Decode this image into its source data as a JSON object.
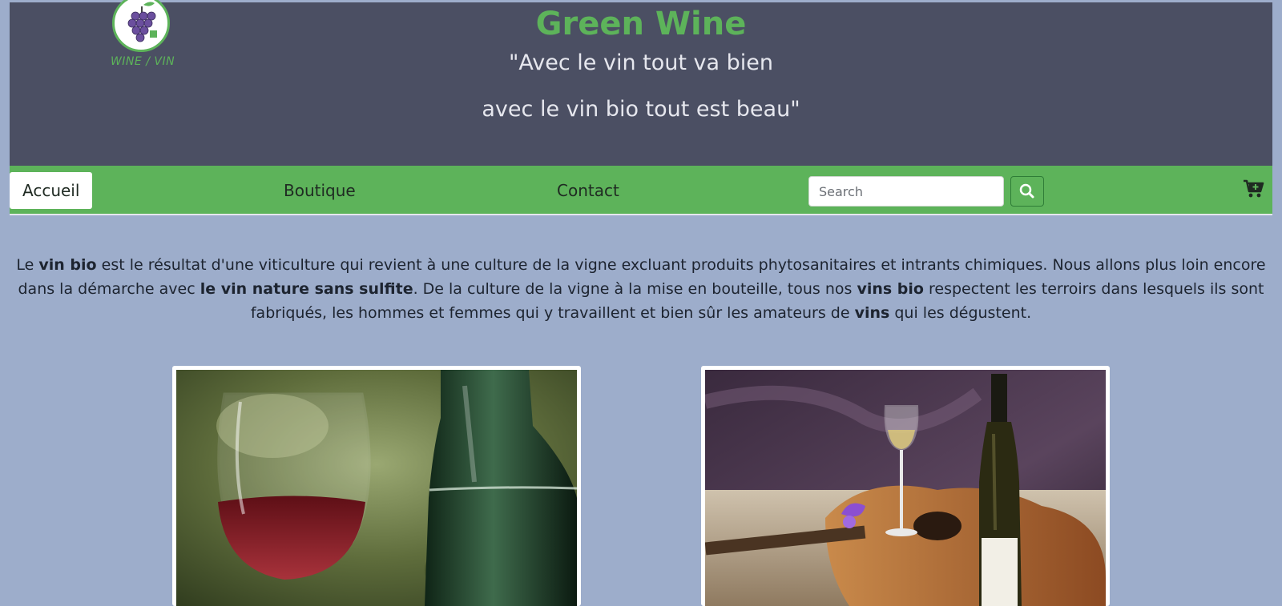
{
  "header": {
    "title": "Green Wine",
    "tagline_line1": "\"Avec le vin tout va bien",
    "tagline_line2": "avec le vin bio tout est beau\"",
    "logo_text": "WINE / VIN"
  },
  "nav": {
    "items": [
      {
        "label": "Accueil"
      },
      {
        "label": "Boutique"
      },
      {
        "label": "Contact"
      }
    ],
    "search_placeholder": "Search",
    "search_icon": "search-icon",
    "cart_icon": "cart-plus-icon"
  },
  "intro": {
    "p1": "Le ",
    "b1": "vin bio",
    "p2": " est le résultat d'une viticulture qui revient à une culture de la vigne excluant produits phytosanitaires et intrants chimiques. Nous allons plus loin encore dans la démarche avec ",
    "b2": "le vin nature sans sulfite",
    "p3": ". De la culture de la vigne à la mise en bouteille, tous nos ",
    "b3": "vins bio",
    "p4": " respectent les terroirs dans lesquels ils sont fabriqués, les hommes et femmes qui y travaillent et bien sûr les amateurs de ",
    "b4": "vins",
    "p5": " qui les dégustent."
  },
  "colors": {
    "accent_green": "#5db35a",
    "header_bg": "#4b4f63",
    "page_bg": "#9dadcb"
  }
}
